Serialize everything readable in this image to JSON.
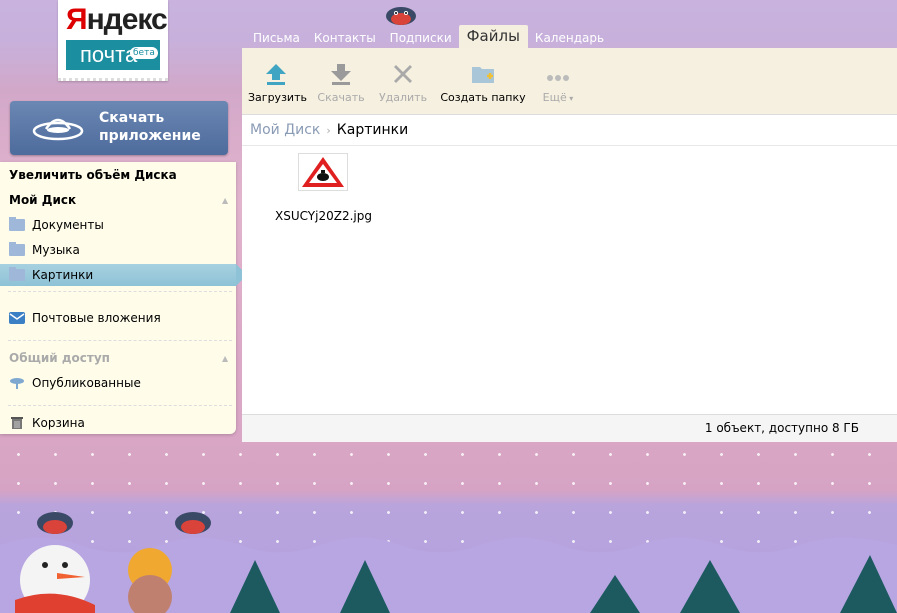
{
  "logo": {
    "brand": "Яндекс",
    "product": "почта",
    "badge": "бета"
  },
  "nav": {
    "tabs": [
      {
        "label": "Письма",
        "active": false
      },
      {
        "label": "Контакты",
        "active": false
      },
      {
        "label": "Подписки",
        "active": false
      },
      {
        "label": "Файлы",
        "active": true
      },
      {
        "label": "Календарь",
        "active": false
      }
    ]
  },
  "toolbar": {
    "upload": "Загрузить",
    "download": "Скачать",
    "delete": "Удалить",
    "new_folder": "Создать папку",
    "more": "Ещё"
  },
  "download_app": {
    "line1": "Скачать",
    "line2": "приложение"
  },
  "sidebar": {
    "increase_space": "Увеличить объём Диска",
    "my_disk": "Мой Диск",
    "folders": [
      "Документы",
      "Музыка",
      "Картинки"
    ],
    "selected_folder": "Картинки",
    "mail_attachments": "Почтовые вложения",
    "shared_header": "Общий доступ",
    "published": "Опубликованные",
    "trash": "Корзина"
  },
  "breadcrumb": {
    "root": "Мой Диск",
    "current": "Картинки"
  },
  "files": [
    {
      "name": "XSUCYj20Z2.jpg"
    }
  ],
  "status": "1 объект, доступно 8 ГБ",
  "colors": {
    "accent": "#1b8ea0",
    "selected": "#8ec2d6",
    "button": "#4d6b9c"
  }
}
